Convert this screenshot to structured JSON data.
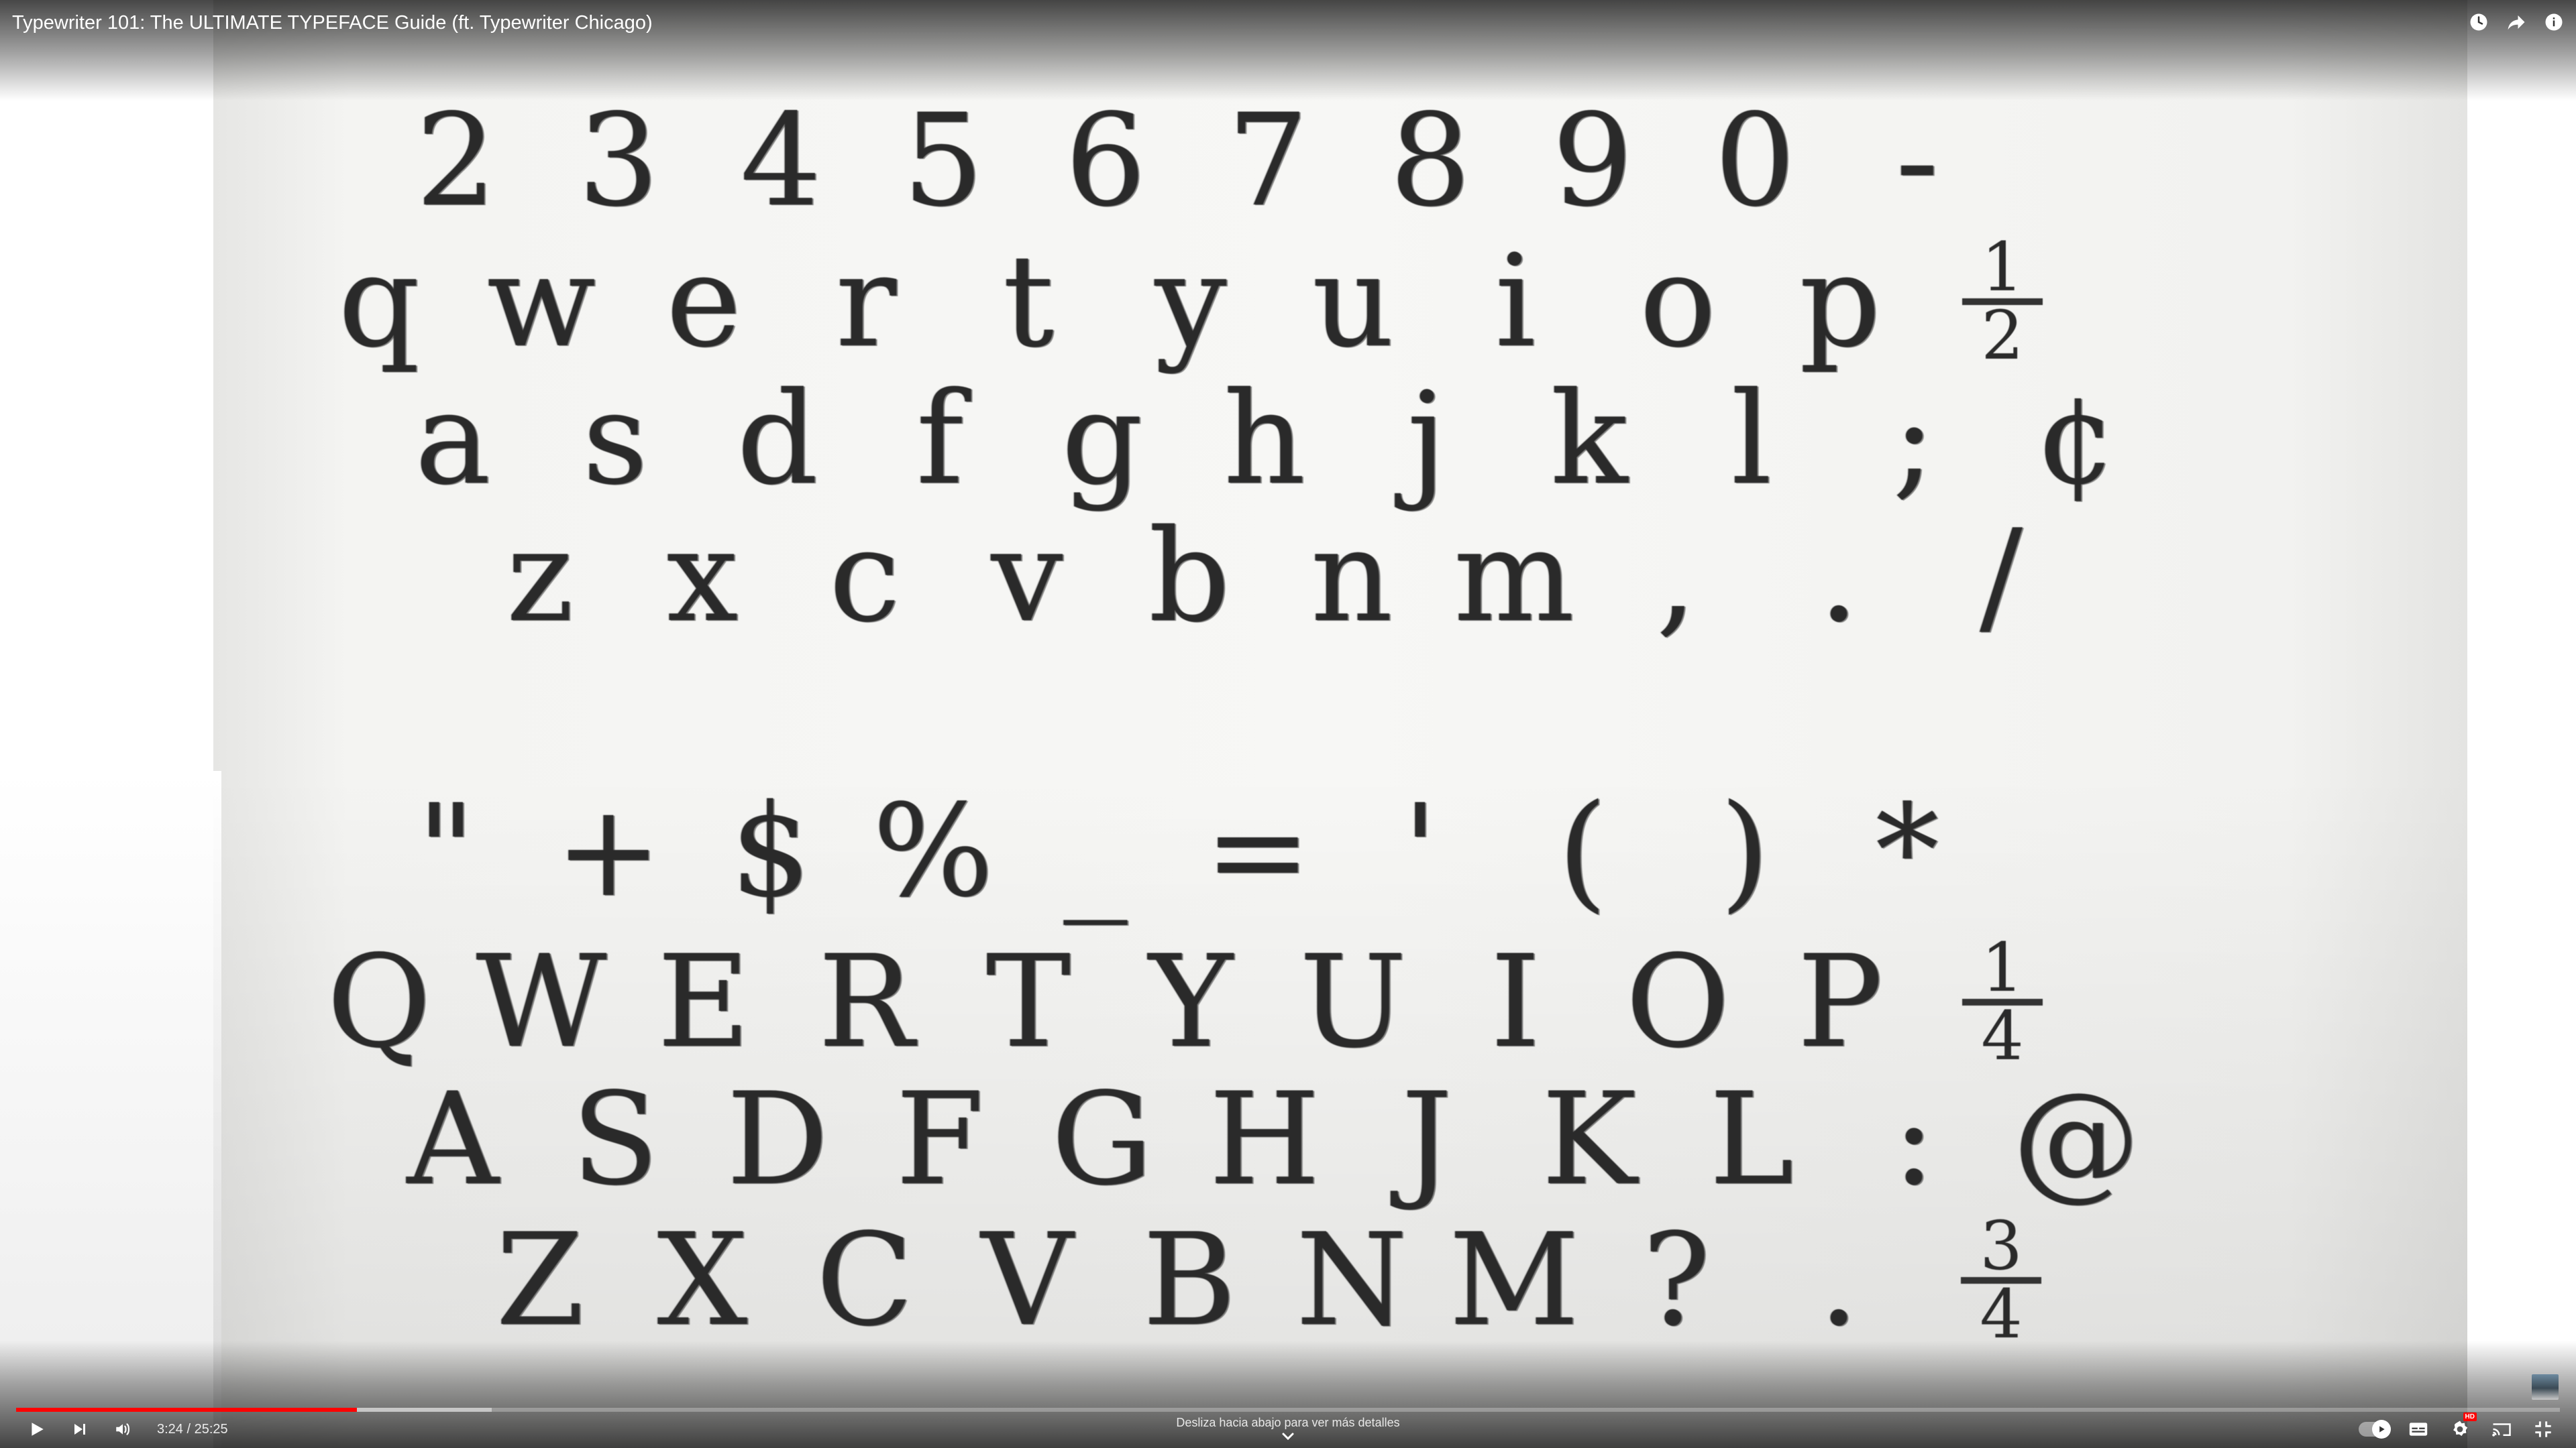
{
  "player": {
    "title": "Typewriter 101: The ULTIMATE TYPEFACE Guide (ft. Typewriter Chicago)",
    "time_current": "3:24",
    "time_separator": " / ",
    "time_total": "25:25",
    "progress_fraction": 0.134,
    "buffered_fraction": 0.187,
    "swipe_hint": "Desliza hacia abajo para ver más detalles",
    "hd_badge": "HD",
    "accent_color": "#ff0000",
    "icons": {
      "watch_later": "clock-icon",
      "share": "share-icon",
      "info": "info-icon",
      "play": "play-icon",
      "next": "next-icon",
      "volume": "volume-icon",
      "autoplay": "autoplay-toggle-icon",
      "captions": "captions-icon",
      "settings": "gear-icon",
      "cast": "cast-icon",
      "fullscreen_exit": "exit-fullscreen-icon",
      "expand": "chevron-down-icon"
    }
  },
  "typeface_sheet": {
    "rows": [
      [
        "2",
        "3",
        "4",
        "5",
        "6",
        "7",
        "8",
        "9",
        "0",
        "-"
      ],
      [
        "q",
        "w",
        "e",
        "r",
        "t",
        "y",
        "u",
        "i",
        "o",
        "p",
        "1/2"
      ],
      [
        "a",
        "s",
        "d",
        "f",
        "g",
        "h",
        "j",
        "k",
        "l",
        ";",
        "¢"
      ],
      [
        "z",
        "x",
        "c",
        "v",
        "b",
        "n",
        "m",
        ",",
        ".",
        "/"
      ],
      [
        "\"",
        "+",
        "$",
        "%",
        "_",
        "=",
        "'",
        "(",
        ")",
        "*"
      ],
      [
        "Q",
        "W",
        "E",
        "R",
        "T",
        "Y",
        "U",
        "I",
        "O",
        "P",
        "1/4"
      ],
      [
        "A",
        "S",
        "D",
        "F",
        "G",
        "H",
        "J",
        "K",
        "L",
        ":",
        "@"
      ],
      [
        "Z",
        "X",
        "C",
        "V",
        "B",
        "N",
        "M",
        "?",
        ".",
        "3/4"
      ]
    ]
  }
}
